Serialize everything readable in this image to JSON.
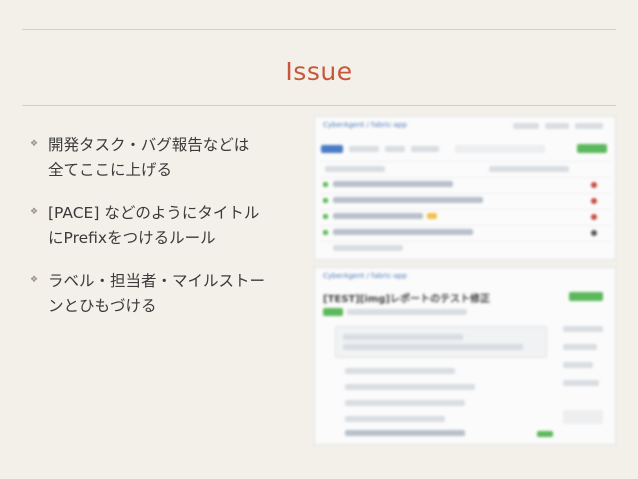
{
  "slide": {
    "title": "Issue"
  },
  "bullets": [
    {
      "line1": "開発タスク・バグ報告などは",
      "line2": "全てここに上げる"
    },
    {
      "line1": "[PACE] などのようにタイトル",
      "line2": "にPrefixをつけるルール"
    },
    {
      "line1": "ラベル・担当者・マイルストー",
      "line2": "ンとひもづける"
    }
  ],
  "screenshot_top": {
    "repo": "CyberAgent / fabric-app",
    "rows": 5
  },
  "screenshot_bottom": {
    "repo": "CyberAgent / fabric-app",
    "issue_title": "[TEST][img]レポートのテスト修正"
  },
  "colors": {
    "accent": "#c7573a",
    "text": "#3a3a3a",
    "background": "#f3f0ea"
  }
}
